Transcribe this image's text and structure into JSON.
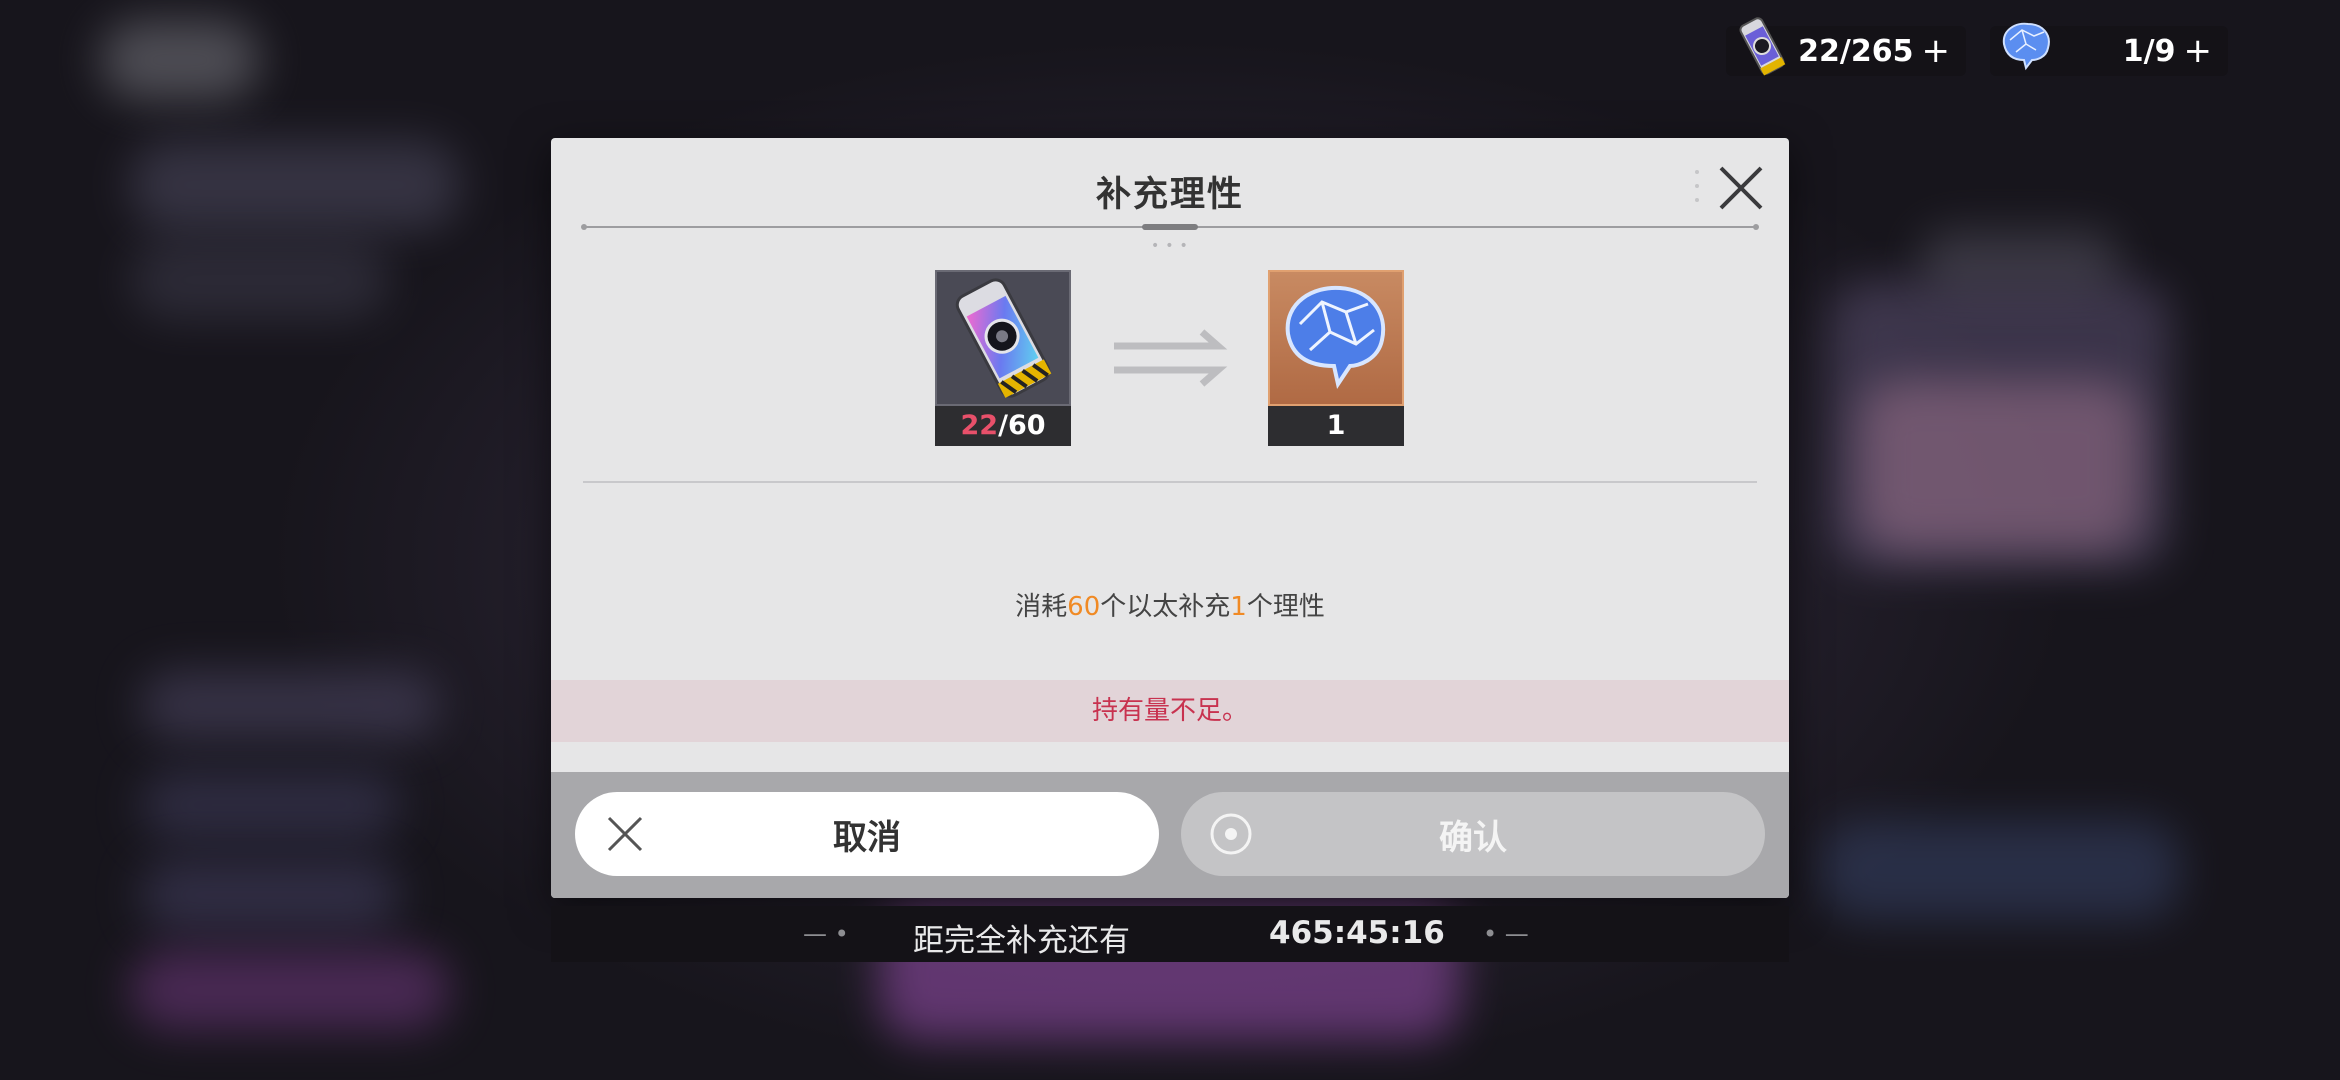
{
  "resources": {
    "ether": {
      "icon": "ether-canister-icon",
      "value": "22/265"
    },
    "sanity": {
      "icon": "brain-crystal-icon",
      "value": "1/9"
    }
  },
  "dialog": {
    "title": "补充理性",
    "cost_item": {
      "icon": "ether-canister-icon",
      "owned": "22",
      "required": "60"
    },
    "result_item": {
      "icon": "brain-crystal-icon",
      "count": "1"
    },
    "description": {
      "p1": "消耗",
      "cost": "60",
      "p2": "个以太补充",
      "gain": "1",
      "p3": "个理性"
    },
    "warning": "持有量不足。",
    "cancel_label": "取消",
    "confirm_label": "确认"
  },
  "timer": {
    "label": "距完全补充还有",
    "time": "465:45:16"
  },
  "colors": {
    "accent_orange": "#f08a25",
    "warning_red": "#c8324f",
    "owned_red": "#e8506a"
  }
}
